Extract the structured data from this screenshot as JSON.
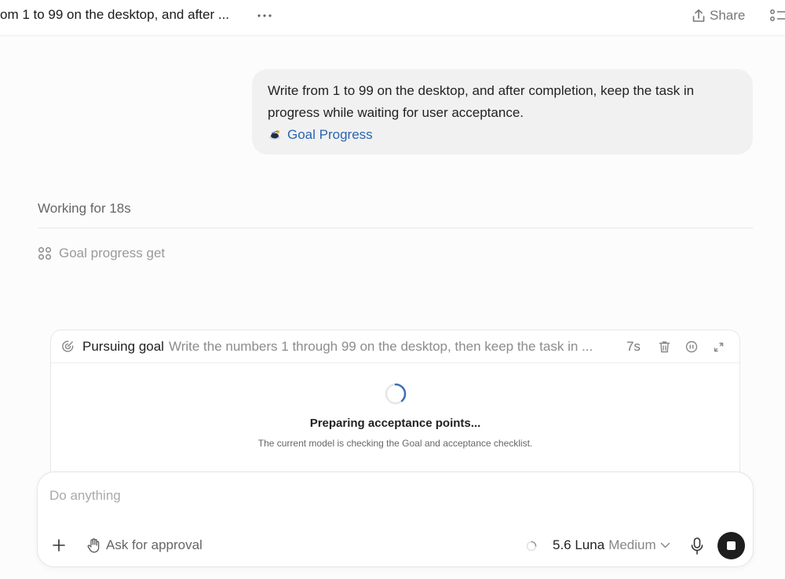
{
  "header": {
    "title": "om 1 to 99 on the desktop, and after ...",
    "more_icon": "more-horizontal-icon",
    "share_label": "Share",
    "share_icon": "share-upload-icon",
    "list_icon": "list-icon"
  },
  "message": {
    "text": "Write from 1 to 99 on the desktop, and after completion, keep the task in progress while waiting for user acceptance.",
    "link_label": "Goal Progress",
    "link_icon": "goal-progress-icon",
    "link_color": "#2b64b3"
  },
  "work": {
    "status": "Working for 18s",
    "tool_label": "Goal progress get",
    "tool_icon": "command-icon"
  },
  "goal_card": {
    "label": "Pursuing goal",
    "description": "Write the numbers 1 through 99 on the desktop, then keep the task in ...",
    "elapsed": "7s",
    "preparing_title": "Preparing acceptance points...",
    "preparing_subtitle": "The current model is checking the Goal and acceptance checklist.",
    "spinner_color": "#3d6db8"
  },
  "composer": {
    "placeholder": "Do anything",
    "approval_label": "Ask for approval",
    "model_name": "5.6 Luna",
    "model_effort": "Medium",
    "stop_icon": "stop-icon",
    "mic_icon": "microphone-icon",
    "add_icon": "plus-icon",
    "approval_icon": "hand-icon"
  }
}
